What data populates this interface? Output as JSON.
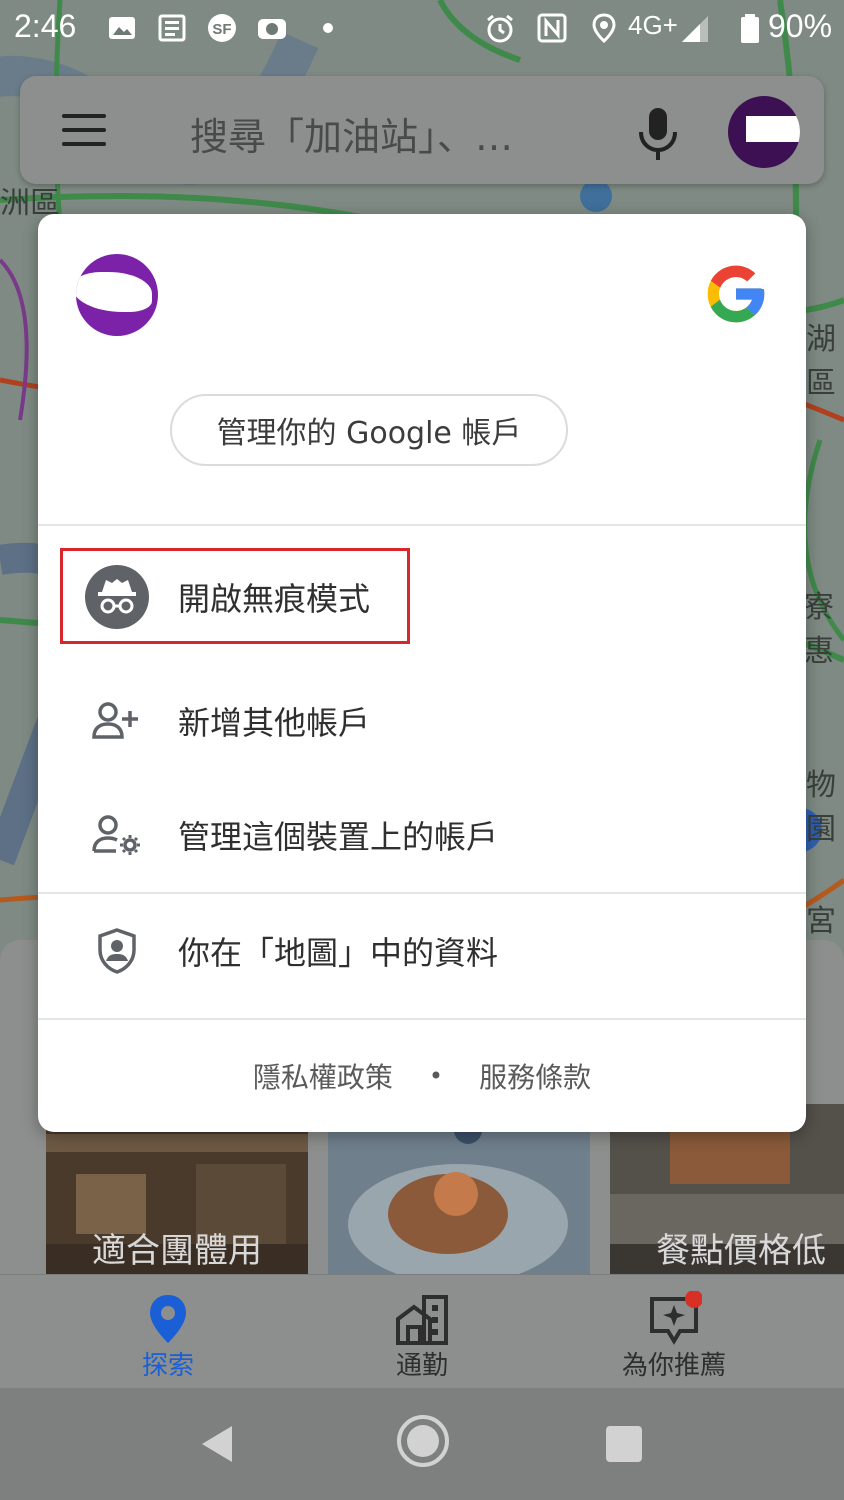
{
  "status_bar": {
    "time": "2:46",
    "network": "4G+",
    "battery": "90%",
    "icons": [
      "image-icon",
      "news-icon",
      "sf-icon",
      "camera-icon",
      "dot-icon",
      "alarm-icon",
      "nfc-icon",
      "location-icon",
      "signal-icon",
      "battery-icon"
    ]
  },
  "search": {
    "placeholder": "搜尋「加油站」、…",
    "icons": [
      "menu-icon",
      "mic-icon",
      "avatar"
    ]
  },
  "map": {
    "labels": [
      "洲區",
      "湖區",
      "寮惠",
      "物園",
      "宮"
    ]
  },
  "account_sheet": {
    "manage_account_label": "管理你的 Google 帳戶",
    "menu": [
      {
        "label": "開啟無痕模式",
        "icon": "incognito-icon"
      },
      {
        "label": "新增其他帳戶",
        "icon": "add-person-icon"
      },
      {
        "label": "管理這個裝置上的帳戶",
        "icon": "manage-accounts-icon"
      },
      {
        "label": "你在「地圖」中的資料",
        "icon": "shield-person-icon"
      }
    ],
    "footer": {
      "privacy": "隱私權政策",
      "separator": "•",
      "terms": "服務條款"
    },
    "highlight_color": "#d9262b"
  },
  "cards": [
    {
      "label": "適合團體用"
    },
    {
      "label": ""
    },
    {
      "label": "餐點價格低"
    }
  ],
  "bottom_nav": {
    "tabs": [
      {
        "label": "探索",
        "icon": "explore-pin-icon",
        "active": true
      },
      {
        "label": "通勤",
        "icon": "commute-icon",
        "active": false
      },
      {
        "label": "為你推薦",
        "icon": "for-you-icon",
        "active": false
      }
    ],
    "active_color": "#1a5fd6"
  },
  "colors": {
    "google_blue": "#4285F4",
    "google_red": "#EA4335",
    "google_yellow": "#FBBC05",
    "google_green": "#34A853"
  }
}
